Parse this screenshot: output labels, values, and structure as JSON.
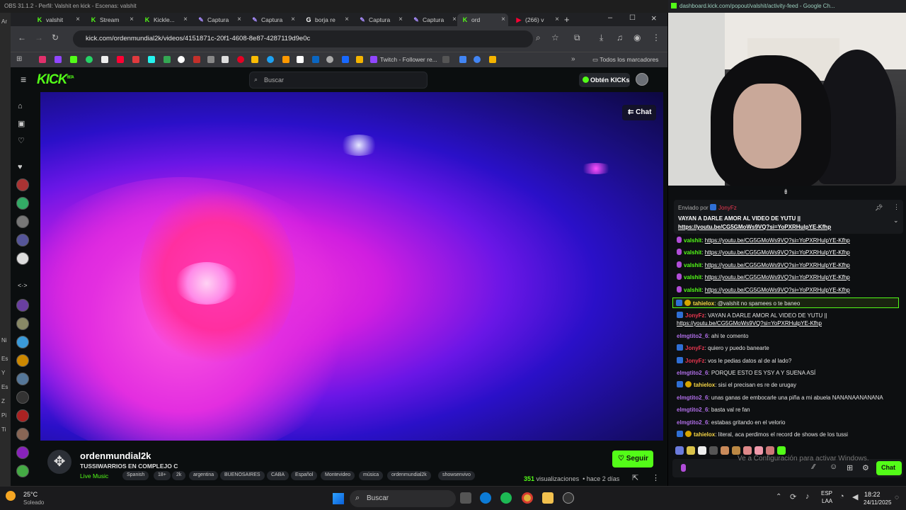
{
  "obs": {
    "title": "OBS 31.1.2 - Perfil: Valshit en kick - Escenas: valshit",
    "strip_labels": [
      "Ar",
      "Ni",
      "Es",
      "Y",
      "Es",
      "Z",
      "Pi",
      "Ti"
    ]
  },
  "browser": {
    "tabs": [
      {
        "label": "valshit",
        "icon": "kick-icon",
        "active": false
      },
      {
        "label": "Stream",
        "icon": "kick-icon",
        "active": false
      },
      {
        "label": "Kickle...",
        "icon": "kick-icon",
        "active": false
      },
      {
        "label": "Captura",
        "icon": "pen-icon",
        "active": false
      },
      {
        "label": "Captura",
        "icon": "pen-icon",
        "active": false
      },
      {
        "label": "borja re",
        "icon": "google-icon",
        "active": false
      },
      {
        "label": "Captura",
        "icon": "pen-icon",
        "active": false
      },
      {
        "label": "Captura",
        "icon": "pen-icon",
        "active": false
      },
      {
        "label": "ord",
        "icon": "kick-icon",
        "active": true
      },
      {
        "label": "(266) v",
        "icon": "youtube-icon",
        "active": false
      }
    ],
    "url": "kick.com/ordenmundial2k/videos/4151871c-20f1-4608-8e87-4287119d9e0c",
    "bookmarks_folder": "Todos los marcadores",
    "bookmark_twitch": "Twitch - Follower re..."
  },
  "kick": {
    "logo": "KICK",
    "logo_badge": "BETA",
    "search_placeholder": "Buscar",
    "get_kicks": "Obtén KICKs",
    "chat_button": "Chat",
    "accent": "#53fc18"
  },
  "video_info": {
    "channel": "ordenmundial2k",
    "title": "TUSSIWARRIOS EN COMPLEJO C",
    "category": "Live Music",
    "tags": [
      "Spanish",
      "18+",
      "2k",
      "argentina",
      "BUENOSAIRES",
      "CABA",
      "Español",
      "Montevideo",
      "música",
      "ordenmundial2k",
      "showsenvivo"
    ],
    "follow": "Seguir",
    "views_count": "351",
    "views_label": "visualizaciones",
    "age": "hace 2 días"
  },
  "popout": {
    "title": "dashboard.kick.com/popout/valshit/activity-feed - Google Ch..."
  },
  "chat": {
    "pinned_by_label": "Enviado por",
    "pinned_by_user": "JonyFz",
    "pinned_text": "VAYAN A DARLE AMOR AL VIDEO DE YUTU ||",
    "pinned_link": "https://youtu.be/CG5GMoWs9VQ?si=YoPXRHulpYE-Kfhp",
    "messages": [
      {
        "user": "valshit",
        "color": "#53fc18",
        "badge": "mic",
        "text": "https://youtu.be/CG5GMoWs9VQ?si=YoPXRHulpYE-Kfhp",
        "link": true
      },
      {
        "user": "valshit",
        "color": "#53fc18",
        "badge": "mic",
        "text": "https://youtu.be/CG5GMoWs9VQ?si=YoPXRHulpYE-Kfhp",
        "link": true
      },
      {
        "user": "valshit",
        "color": "#53fc18",
        "badge": "mic",
        "text": "https://youtu.be/CG5GMoWs9VQ?si=YoPXRHulpYE-Kfhp",
        "link": true
      },
      {
        "user": "valshit",
        "color": "#53fc18",
        "badge": "mic",
        "text": "https://youtu.be/CG5GMoWs9VQ?si=YoPXRHulpYE-Kfhp",
        "link": true
      },
      {
        "user": "valshit",
        "color": "#53fc18",
        "badge": "mic",
        "text": "https://youtu.be/CG5GMoWs9VQ?si=YoPXRHulpYE-Kfhp",
        "link": true
      },
      {
        "user": "tahielox",
        "color": "#f5d547",
        "badge": "mod",
        "text": "@valshit no spamees o te baneo",
        "highlight": true
      },
      {
        "user": "JonyFz",
        "color": "#e8364f",
        "badge": "mod",
        "text": "VAYAN A DARLE AMOR AL VIDEO DE YUTU ||"
      },
      {
        "user": "",
        "color": "#fff",
        "badge": "",
        "text": "https://youtu.be/CG5GMoWs9VQ?si=YoPXRHulpYE-Kfhp",
        "link": true
      },
      {
        "user": "elmgtito2_6",
        "color": "#b06ee8",
        "badge": "",
        "text": "ahi te comento"
      },
      {
        "user": "JonyFz",
        "color": "#e8364f",
        "badge": "mod",
        "text": "quiero y puedo banearte"
      },
      {
        "user": "JonyFz",
        "color": "#e8364f",
        "badge": "mod",
        "text": "vos le pedias datos al de al lado?"
      },
      {
        "user": "elmgtito2_6",
        "color": "#b06ee8",
        "badge": "",
        "text": "PORQUE ESTO ES YSY A Y SUENA ASÍ"
      },
      {
        "user": "tahielox",
        "color": "#f5d547",
        "badge": "mod",
        "text": "sisi el precisan es re de urugay"
      },
      {
        "user": "elmgtito2_6",
        "color": "#b06ee8",
        "badge": "",
        "text": "unas ganas de embocarle una piña a mi abuela NANANAANANANA"
      },
      {
        "user": "elmgtito2_6",
        "color": "#b06ee8",
        "badge": "",
        "text": "basta val re fan"
      },
      {
        "user": "elmgtito2_6",
        "color": "#b06ee8",
        "badge": "",
        "text": "estabas gritando en el velorio"
      },
      {
        "user": "tahielox",
        "color": "#f5d547",
        "badge": "mod",
        "text": "literal, aca perdimos el record de shows de los tussi"
      }
    ],
    "send_button": "Chat",
    "activate_windows": "Ve a Configuración para activar Windows."
  },
  "taskbar": {
    "weather_temp": "25°C",
    "weather_desc": "Soleado",
    "search": "Buscar",
    "lang": "ESP",
    "lang2": "LAA",
    "time": "18:22",
    "date": "24/11/2025"
  }
}
